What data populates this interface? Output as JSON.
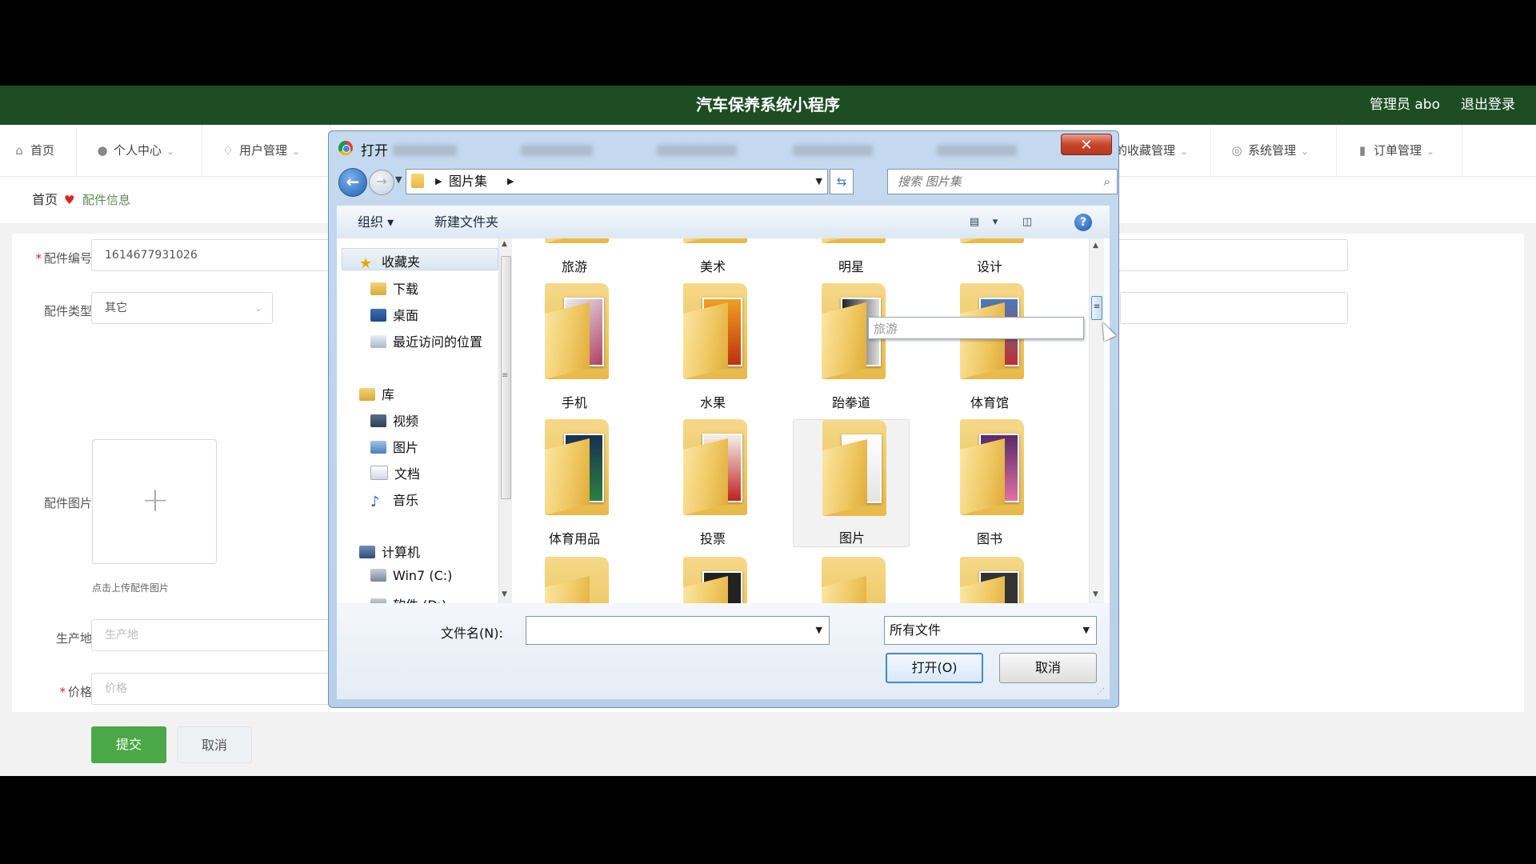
{
  "app": {
    "title": "汽车保养系统小程序",
    "user": "管理员 abo",
    "logout": "退出登录"
  },
  "nav": {
    "home": "首页",
    "personal": "个人中心",
    "users": "用户管理",
    "favorites": "的收藏管理",
    "system": "系统管理",
    "orders": "订单管理"
  },
  "breadcrumb": {
    "home": "首页",
    "current": "配件信息"
  },
  "form": {
    "code_label": "配件编号",
    "code_value": "1614677931026",
    "type_label": "配件类型",
    "type_value": "其它",
    "image_label": "配件图片",
    "upload_hint": "点击上传配件图片",
    "origin_label": "生产地",
    "origin_placeholder": "生产地",
    "price_label": "价格",
    "price_placeholder": "价格",
    "submit": "提交",
    "cancel": "取消"
  },
  "dialog": {
    "title": "打开",
    "close": "✕",
    "path": "图片集",
    "search_placeholder": "搜索 图片集",
    "organize": "组织",
    "new_folder": "新建文件夹",
    "tree": {
      "favorites": "收藏夹",
      "downloads": "下载",
      "desktop": "桌面",
      "recent": "最近访问的位置",
      "libraries": "库",
      "videos": "视频",
      "pictures": "图片",
      "documents": "文档",
      "music": "音乐",
      "computer": "计算机",
      "drive_c": "Win7 (C:)",
      "drive_d": "软件 (D:)"
    },
    "folders": [
      "旅游",
      "美术",
      "明星",
      "设计",
      "手机",
      "水果",
      "跆拳道",
      "体育馆",
      "体育用品",
      "投票",
      "图片",
      "图书"
    ],
    "tooltip": "旅游",
    "filename_label": "文件名(N):",
    "filename_value": "",
    "filetype": "所有文件",
    "open_button": "打开(O)",
    "cancel_button": "取消"
  },
  "colors": {
    "header": "#1e4d23",
    "submit": "#4aa846",
    "required": "#e02020",
    "folder": "#efc761"
  }
}
